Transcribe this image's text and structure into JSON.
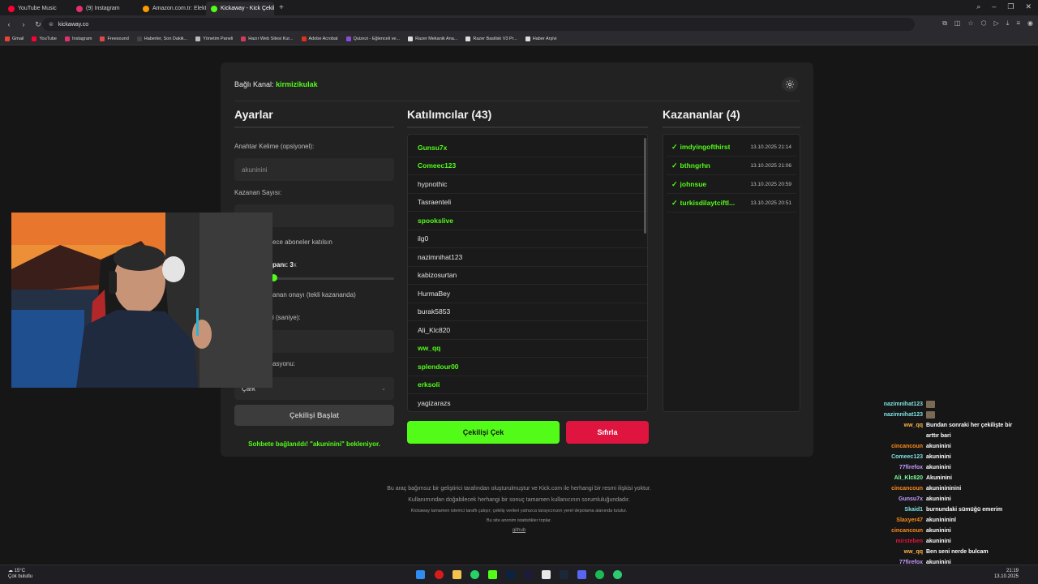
{
  "browser": {
    "tabs": [
      {
        "label": "YouTube Music",
        "color": "#ff0033"
      },
      {
        "label": "(9) Instagram",
        "color": "#e1306c"
      },
      {
        "label": "Amazon.com.tr: Elektronik",
        "color": "#ff9900"
      },
      {
        "label": "Kickaway - Kick Çekiliş Ar",
        "color": "#53fc18"
      }
    ],
    "url": "kickaway.co",
    "bookmarks": [
      {
        "label": "Gmail",
        "color": "#ea4335"
      },
      {
        "label": "YouTube",
        "color": "#ff0033"
      },
      {
        "label": "Instagram",
        "color": "#e1306c"
      },
      {
        "label": "Freesound",
        "color": "#e24a4a"
      },
      {
        "label": "Haberler, Son Dakik...",
        "color": "#444444"
      },
      {
        "label": "Yönetim Paneli",
        "color": "#bbbbbb"
      },
      {
        "label": "Hazır Web Sitesi Kur...",
        "color": "#d23b5b"
      },
      {
        "label": "Adobe Acrobat",
        "color": "#e0301e"
      },
      {
        "label": "Quizezi - Eğlenceli ve...",
        "color": "#8a4dd6"
      },
      {
        "label": "Razer Mekanik Ana...",
        "color": "#dddddd"
      },
      {
        "label": "Razer Basilisk V3 Pr...",
        "color": "#dddddd"
      },
      {
        "label": "Haber Arşivi",
        "color": "#dddddd"
      }
    ]
  },
  "app": {
    "channel_label": "Bağlı Kanal:",
    "channel_name": "kirmizikulak",
    "settings": {
      "title": "Ayarlar",
      "keyword_label": "Anahtar Kelime (opsiyonel):",
      "keyword_value": "akuninini",
      "winner_count_label": "Kazanan Sayısı:",
      "subs_only_label": "ece aboneler katılsın",
      "multiplier_label": "panı: 3",
      "multiplier_suffix": "x",
      "approval_label": "anan onayı (tekli kazananda)",
      "time_label": "i (saniye):",
      "animation_label": "asyonu:",
      "animation_value": "Çark",
      "start_button": "Çekilişi Başlat",
      "status": "Sohbete bağlanıldı! \"akuninini\" bekleniyor."
    },
    "participants": {
      "title": "Katılımcılar (43)",
      "items": [
        {
          "name": "Gunsu7x",
          "sub": true
        },
        {
          "name": "Comeec123",
          "sub": true
        },
        {
          "name": "hypnothic",
          "sub": false
        },
        {
          "name": "Tasraenteli",
          "sub": false
        },
        {
          "name": "spookslive",
          "sub": true
        },
        {
          "name": "ilg0",
          "sub": false
        },
        {
          "name": "nazimnihat123",
          "sub": false
        },
        {
          "name": "kabizosurtan",
          "sub": false
        },
        {
          "name": "HurmaBey",
          "sub": false
        },
        {
          "name": "burak5853",
          "sub": false
        },
        {
          "name": "Ali_Klc820",
          "sub": false
        },
        {
          "name": "ww_qq",
          "sub": true
        },
        {
          "name": "splendour00",
          "sub": true
        },
        {
          "name": "erksoli",
          "sub": true
        },
        {
          "name": "yagizarazs",
          "sub": false
        }
      ],
      "draw_button": "Çekilişi Çek",
      "reset_button": "Sıfırla"
    },
    "winners": {
      "title": "Kazananlar (4)",
      "items": [
        {
          "name": "imdyingofthirst",
          "time": "13.10.2025 21:14"
        },
        {
          "name": "bthngrhn",
          "time": "13.10.2025 21:06"
        },
        {
          "name": "johnsue",
          "time": "13.10.2025 20:59"
        },
        {
          "name": "turkisdilaytciftl...",
          "time": "13.10.2025 20:51"
        }
      ]
    },
    "footer": {
      "line1": "Bu araç bağımsız bir geliştirici tarafından oluşturulmuştur ve Kick.com ile herhangi bir resmi ilişkisi yoktur.",
      "line2": "Kullanımından doğabilecek herhangi bir sonuç tamamen kullanıcının sorumluluğundadır.",
      "line3": "Kickaway tamamen istemci taraflı çalışır; çekiliş verileri yalnızca tarayıcınızın yerel depolama alanında tutulur.",
      "line4": "Bu site anonim istatistikler toplar.",
      "link": "github"
    }
  },
  "chat": [
    {
      "user": "nazimnihat123",
      "msg": "",
      "color": "#7ee0e0"
    },
    {
      "user": "nazimnihat123",
      "msg": "",
      "color": "#7ee0e0"
    },
    {
      "user": "ww_qq",
      "msg": "Bundan sonraki her çekilişte bir",
      "color": "#ffb347"
    },
    {
      "user": "",
      "msg": "arttır bari",
      "color": "#ffb347"
    },
    {
      "user": "cincancoun",
      "msg": "akuninini",
      "color": "#ff8c1a"
    },
    {
      "user": "Comeec123",
      "msg": "akuninini",
      "color": "#7ee0e0"
    },
    {
      "user": "77firefox",
      "msg": "akuninini",
      "color": "#c59cff"
    },
    {
      "user": "Ali_Klc820",
      "msg": "Akuninini",
      "color": "#7dffa0"
    },
    {
      "user": "cincancoun",
      "msg": "akuninininini",
      "color": "#ff8c1a"
    },
    {
      "user": "Gunsu7x",
      "msg": "akuninini",
      "color": "#c59cff"
    },
    {
      "user": "Skaid1",
      "msg": "burnundaki sümüğü emerim",
      "color": "#7ee0e0"
    },
    {
      "user": "Slaxyer47",
      "msg": "akuninininl",
      "color": "#ff8c1a"
    },
    {
      "user": "cincancoun",
      "msg": "akuninini",
      "color": "#ff8c1a"
    },
    {
      "user": "mirsteben",
      "msg": "akuninini",
      "color": "#e0153f"
    },
    {
      "user": "ww_qq",
      "msg": "Ben seni nerde bulcam",
      "color": "#ffb347"
    },
    {
      "user": "77firefox",
      "msg": "akuninini",
      "color": "#c59cff"
    },
    {
      "user": "cincancoun",
      "msg": "akuninini",
      "color": "#ff8c1a"
    }
  ],
  "taskbar": {
    "temp": "15°C",
    "weather": "Çok bulutlu",
    "time": "21:19",
    "date": "13.10.2025"
  },
  "colors": {
    "accent": "#53fc18",
    "danger": "#e0153f",
    "panel": "#222222",
    "background": "#161616"
  }
}
